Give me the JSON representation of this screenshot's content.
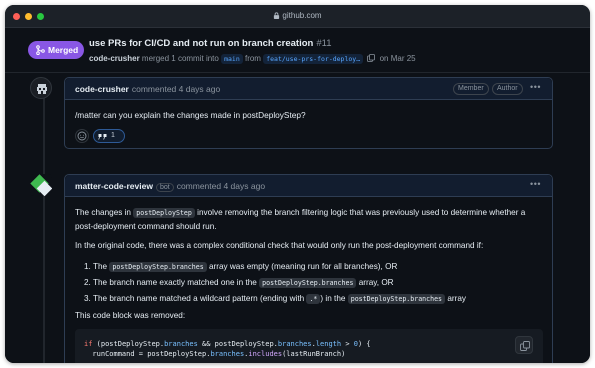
{
  "browser": {
    "url": "github.com"
  },
  "pr": {
    "status": "Merged",
    "title": "use PRs for CI/CD and not run on branch creation",
    "number": "#11",
    "author": "code-crusher",
    "meta_text": "merged 1 commit into",
    "base_branch": "main",
    "from_text": "from",
    "head_branch": "feat/use-prs-for-deploy…",
    "date_text": "on Mar 25"
  },
  "comment1": {
    "author": "code-crusher",
    "action": "commented 4 days ago",
    "badges": [
      "Member",
      "Author"
    ],
    "body": "/matter can you explain the changes made in postDeployStep?",
    "reaction_count": "1"
  },
  "comment2": {
    "author": "matter-code-review",
    "bot_label": "bot",
    "action": "commented 4 days ago",
    "p1_a": "The changes in",
    "p1_code": "postDeployStep",
    "p1_b": "involve removing the branch filtering logic that was previously used to determine whether a",
    "p1_c": "post-deployment command should run.",
    "p2": "In the original code, there was a complex conditional check that would only run the post-deployment command if:",
    "items": [
      {
        "num": "1.",
        "a": "The",
        "code": "postDeployStep.branches",
        "b": "array was empty (meaning run for all branches), OR"
      },
      {
        "num": "2.",
        "a": "The branch name exactly matched one in the",
        "code": "postDeployStep.branches",
        "b": "array, OR"
      },
      {
        "num": "3.",
        "a": "The branch name matched a wildcard pattern (ending with",
        "code": ".*",
        "b": ") in the",
        "code2": "postDeployStep.branches",
        "c": "array"
      }
    ],
    "p3": "This code block was removed:",
    "code_lines": [
      "if (postDeployStep.branches && postDeployStep.branches.length > 0) {",
      "  runCommand = postDeployStep.branches.includes(lastRunBranch)"
    ]
  },
  "colors": {
    "merged": "#8957e5",
    "background": "#0d1117",
    "comment_header": "#121d2f",
    "link": "#58a6ff"
  },
  "icons": [
    "lock-icon",
    "merge-icon",
    "copy-icon",
    "kebab-icon",
    "smiley-icon",
    "quote-icon"
  ]
}
